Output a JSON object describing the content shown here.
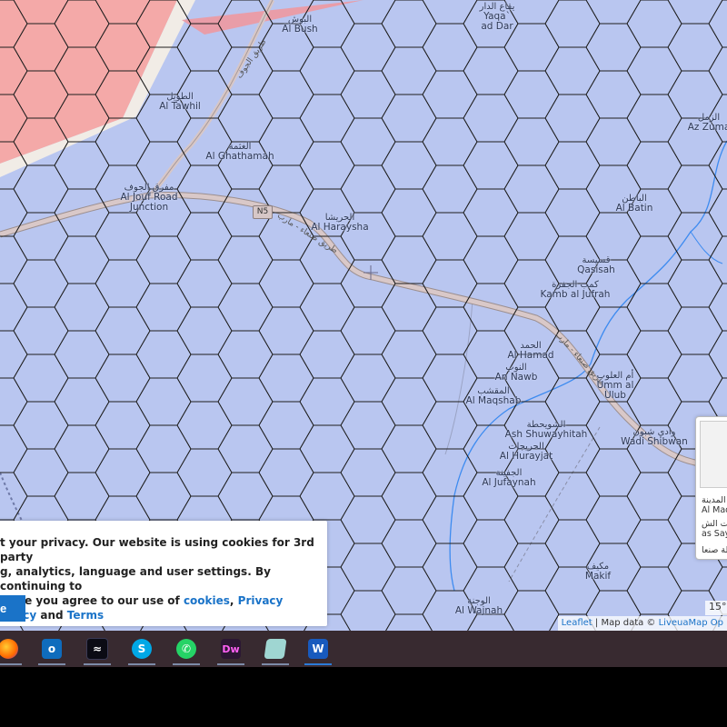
{
  "map": {
    "labels": [
      {
        "id": "al-bush",
        "ar": "البوش",
        "en": "Al Bush"
      },
      {
        "id": "yaqa-ad-dar",
        "ar": "يقاع الدار",
        "en": "Yaqa` ad Dar"
      },
      {
        "id": "al-tawhil",
        "ar": "الطويل",
        "en": "Al Tawhil"
      },
      {
        "id": "al-ghathamah",
        "ar": "الغثمة",
        "en": "Al Ghathamah"
      },
      {
        "id": "al-jouf-road-junction",
        "ar": "مفرق الجوف",
        "en": "Al Jouf Road Junction"
      },
      {
        "id": "al-haraysha",
        "ar": "الحريشا",
        "en": "Al Haraysha"
      },
      {
        "id": "az-zuma",
        "ar": "الزمل",
        "en": "Az Zuma"
      },
      {
        "id": "al-batin",
        "ar": "الباطن",
        "en": "Al Batin"
      },
      {
        "id": "qasisah",
        "ar": "قسيسة",
        "en": "Qasisah"
      },
      {
        "id": "kamb-al-jufrah",
        "ar": "كمب الجفرة",
        "en": "Kamb al Jufrah"
      },
      {
        "id": "al-hamad",
        "ar": "الحمد",
        "en": "Al Hamad"
      },
      {
        "id": "an-nawb",
        "ar": "النوب",
        "en": "An Nawb"
      },
      {
        "id": "umm-al-ulub",
        "ar": "أم العلوب",
        "en": "Umm al Ulub"
      },
      {
        "id": "al-maqshab",
        "ar": "المقشب",
        "en": "Al Maqshab"
      },
      {
        "id": "ash-shuwayhitah",
        "ar": "الشويحطة",
        "en": "Ash Shuwayhitah"
      },
      {
        "id": "al-hurayjat",
        "ar": "الحريجات",
        "en": "Al Hurayjat"
      },
      {
        "id": "wadi-shibwan",
        "ar": "وادي شبون",
        "en": "Wadi Shibwan"
      },
      {
        "id": "al-jufaynah",
        "ar": "الجفينة",
        "en": "Al Jufaynah"
      },
      {
        "id": "makif",
        "ar": "مكيف",
        "en": "Makif"
      },
      {
        "id": "al-wajnah",
        "ar": "الوجنة",
        "en": "Al Wajnah"
      }
    ],
    "road_shield": "N5",
    "road_name_ar": "طريق صنعاء - مارب",
    "road_name_ar_2": "طريق الجوف",
    "colors": {
      "water": "#b9c6f0",
      "restricted_zone": "#f4a9a8",
      "road": "#c9b5b5",
      "river": "#3d8bf0",
      "hex_stroke": "#1e1e1e"
    }
  },
  "cookie_banner": {
    "line1": "t your privacy. Our website is using cookies for 3rd party",
    "line2": "g, analytics, language and user settings. By continuing to",
    "line3_prefix": "r site you agree to our use of ",
    "link_cookies": "cookies",
    "sep": ", ",
    "link_privacy": "Privacy Policy",
    "and": " and ",
    "link_terms": "Terms",
    "button": "e"
  },
  "attribution": {
    "leaflet": "Leaflet",
    "sep": " | Map data © ",
    "provider": "LiveuaMap Op"
  },
  "scale": "15°",
  "side_panel": {
    "lines": [
      "المدينة",
      "Al Mad",
      "بيت الش",
      "as Say",
      "طة صنعا"
    ]
  },
  "taskbar": {
    "apps": [
      {
        "name": "firefox-icon",
        "label": "Firefox"
      },
      {
        "name": "outlook-icon",
        "label": "Outlook"
      },
      {
        "name": "terminal-icon",
        "label": ""
      },
      {
        "name": "skype-icon",
        "label": "S"
      },
      {
        "name": "whatsapp-icon",
        "label": ""
      },
      {
        "name": "dreamweaver-icon",
        "label": "Dw"
      },
      {
        "name": "notepad-icon",
        "label": ""
      },
      {
        "name": "word-icon",
        "label": "W"
      }
    ]
  }
}
